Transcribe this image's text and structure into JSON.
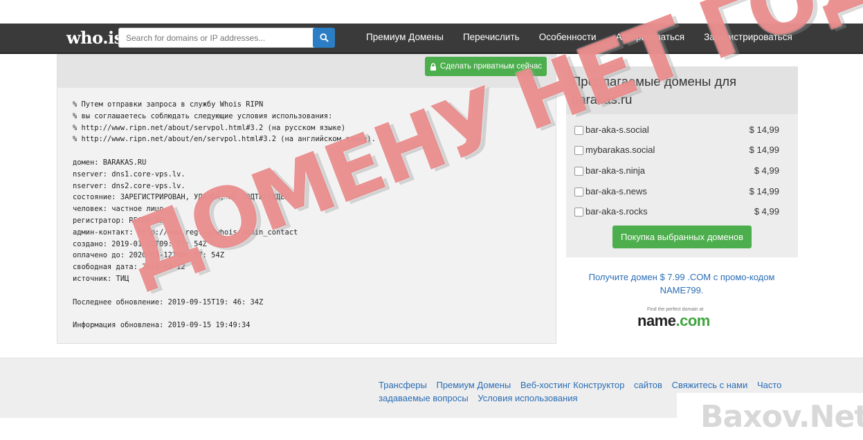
{
  "navbar": {
    "logo": "who.is",
    "search_placeholder": "Search for domains or IP addresses...",
    "links": [
      "Премиум Домены",
      "Перечислить",
      "Особенности",
      "Авторизоваться",
      "Зарегистрироваться"
    ]
  },
  "whois": {
    "private_button": "Сделать приватным сейчас",
    "lines": [
      "% Путем отправки запроса в службу Whois RIPN",
      "% вы соглашаетесь соблюдать следующие условия использования:",
      "% http://www.ripn.net/about/servpol.html#3.2 (на русском языке)",
      "% http://www.ripn.net/about/en/servpol.html#3.2 (на английском языке).",
      "",
      "домен: BARAKAS.RU",
      "nserver: dns1.core-vps.lv.",
      "nserver: dns2.core-vps.lv.",
      "состояние: ЗАРЕГИСТРИРОВАН, УДАЛЕН, НЕ ПОДТВЕРЖДЕН",
      "человек: частное лицо",
      "регистратор: REGRU-RU",
      "админ-контакт: http://www.reg.ru/whois/admin_contact",
      "создано: 2019-01-12T09: 57: 54Z",
      "оплачено до: 2020-01-12T09: 57: 54Z",
      "свободная дата: 2020-02-12",
      "источник: ТИЦ",
      "",
      "Последнее обновление: 2019-09-15T19: 46: 34Z",
      "",
      "Информация обновлена: 2019-09-15 19:49:34"
    ]
  },
  "suggestions": {
    "title": "Предлагаемые домены для barakas.ru",
    "items": [
      {
        "name": "bar-aka-s.social",
        "price": "$ 14,99"
      },
      {
        "name": "mybarakas.social",
        "price": "$ 14,99"
      },
      {
        "name": "bar-aka-s.ninja",
        "price": "$ 4,99"
      },
      {
        "name": "bar-aka-s.news",
        "price": "$ 14,99"
      },
      {
        "name": "bar-aka-s.rocks",
        "price": "$ 4,99"
      }
    ],
    "buy_button": "Покупка выбранных доменов"
  },
  "promo": {
    "text": "Получите домен $ 7.99 .COM с промо-кодом NAME799.",
    "ad_small": "Find the perfect domain at",
    "ad_brand_name": "name",
    "ad_brand_tld": ".com"
  },
  "footer": {
    "links": [
      "Трансферы",
      "Премиум Домены",
      "Веб-хостинг Конструктор",
      "сайтов",
      "Свяжитесь с нами",
      "Часто задаваемые вопросы",
      "Условия использования"
    ]
  },
  "watermark": {
    "text": "ДОМЕНУ НЕТ ГОДА",
    "corner": "Baxov.Net"
  },
  "colors": {
    "navbar": "#3a3a3a",
    "search_button": "#2c7ec4",
    "green_button": "#4cae4c",
    "link": "#2a6db5",
    "watermark": "#de5050"
  }
}
